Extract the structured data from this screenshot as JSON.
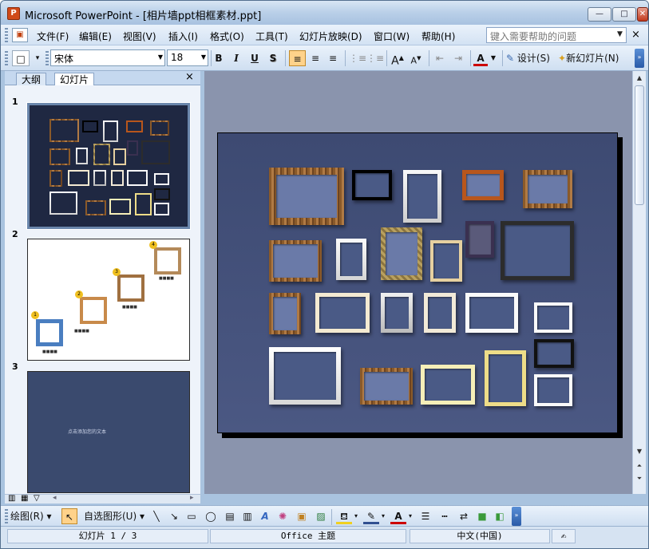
{
  "window": {
    "title": "Microsoft PowerPoint - [相片墙ppt相框素材.ppt]",
    "app_icon": "P",
    "controls": {
      "minimize": "—",
      "maximize": "□",
      "close": "✕"
    }
  },
  "menu": {
    "items": [
      "文件(F)",
      "编辑(E)",
      "视图(V)",
      "插入(I)",
      "格式(O)",
      "工具(T)",
      "幻灯片放映(D)",
      "窗口(W)",
      "帮助(H)"
    ],
    "help_placeholder": "键入需要帮助的问题",
    "close_glyph": "×"
  },
  "format_toolbar": {
    "font": "宋体",
    "size": "18",
    "bold": "B",
    "italic": "I",
    "underline": "U",
    "shadow": "S",
    "grow": "A",
    "shrink": "A",
    "font_color": "A",
    "design_label": "设计(S)",
    "new_slide_label": "新幻灯片(N)"
  },
  "left_pane": {
    "tabs": [
      "大纲",
      "幻灯片"
    ],
    "active_tab": "幻灯片",
    "close_glyph": "×",
    "slide_numbers": [
      "1",
      "2",
      "3"
    ],
    "slide2_caption_a": "■■■■",
    "slide3_text": "点击添加您的文本"
  },
  "draw_toolbar": {
    "draw_label": "绘图(R)",
    "autoshape_label": "自选图形(U)"
  },
  "status": {
    "slide_info": "幻灯片 1 / 3",
    "theme": "Office 主题",
    "language": "中文(中国)"
  },
  "colors": {
    "slide_bg": "#3d4a72",
    "accent": "#f39c12",
    "window_frame": "#a9c3df"
  }
}
